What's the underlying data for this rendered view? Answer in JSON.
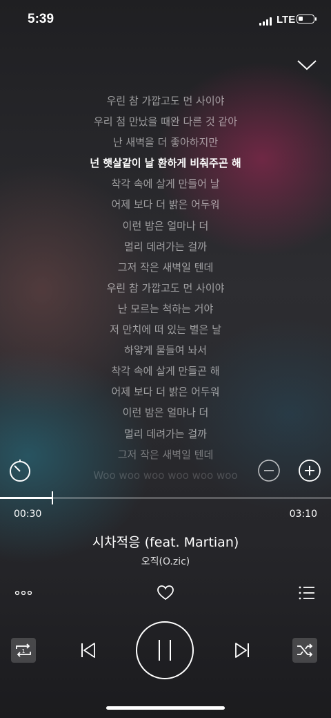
{
  "status_bar": {
    "time": "5:39",
    "network": "LTE"
  },
  "lyrics": [
    "우린 참 가깝고도 먼 사이야",
    "우리 첨 만났을 때완 다른 것 같아",
    "난 새벽을 더 좋아하지만",
    "넌 햇살같이 날 환하게 비춰주곤 해",
    "착각 속에 살게 만들어 날",
    "어제 보다 더 밝은 어두워",
    "이런 밤은 얼마나 더",
    "멀리 데려가는 걸까",
    "그저 작은 새벽일 텐데",
    "우린 참 가깝고도 먼 사이야",
    "난 모르는 척하는 거야",
    "저 만치에 떠 있는 별은 날",
    "하얗게 물들여 놔서",
    "착각 속에 살게 만들곤 해",
    "어제 보다 더 밝은 어두워",
    "이런 밤은 얼마나 더",
    "멀리 데려가는 걸까",
    "그저 작은 새벽일 텐데",
    "Woo woo woo woo woo woo"
  ],
  "active_lyric_index": 3,
  "player": {
    "elapsed": "00:30",
    "duration": "03:10",
    "progress_fraction": 0.158
  },
  "track": {
    "title": "시차적응 (feat. Martian)",
    "artist": "오직(O.zic)"
  },
  "icons": {
    "collapse": "chevron-down-icon",
    "timer": "timer-icon",
    "lyrics_smaller": "minus-circle-icon",
    "lyrics_larger": "plus-circle-icon",
    "more": "more-dots-icon",
    "like": "heart-icon",
    "playlist": "playlist-icon",
    "repeat": "repeat-one-icon",
    "previous": "previous-icon",
    "pause": "pause-icon",
    "next": "next-icon",
    "shuffle": "shuffle-icon"
  }
}
